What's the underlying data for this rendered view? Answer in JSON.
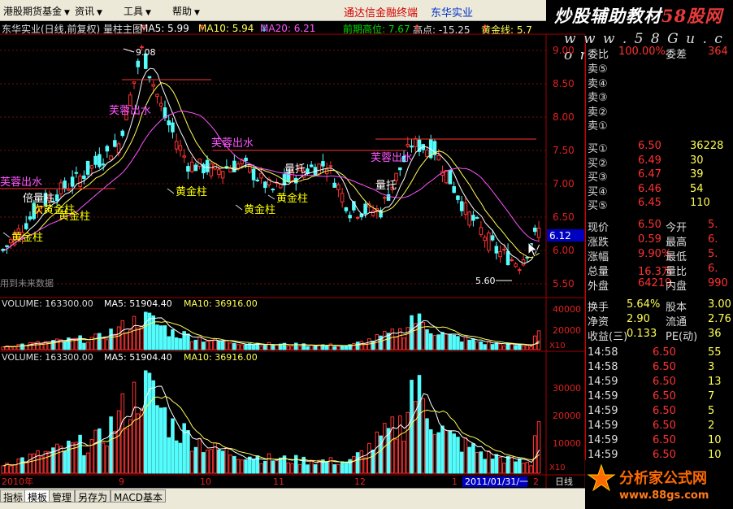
{
  "menu": {
    "items": [
      "港股期货基金",
      "资讯",
      "工具",
      "帮助"
    ],
    "links": [
      "通达信金融终端",
      "东华实业"
    ]
  },
  "logo": {
    "title_prefix": "炒股辅助教材",
    "title_suffix": "58股网",
    "url": "w w w . 5 8 G u . c o m"
  },
  "infobar": {
    "chart_name": "东华实业(日线,前复权) 量柱主图",
    "ma5": "MA5: 5.99",
    "ma10": "MA10: 5.94",
    "ma20": "MA20: 6.21",
    "high_prev": "前期高位: 7.67",
    "high": "高点: -15.25",
    "gold": "黄金线: 5.7"
  },
  "colors": {
    "up": "#ff3232",
    "down": "#54fcfc",
    "ma5": "#ffffff",
    "ma10": "#ffff54",
    "ma20": "#ff54ff",
    "grid": "#a00000",
    "label": "#ffff00",
    "green": "#00cc00"
  },
  "main_chart": {
    "y_axis": [
      "9.00",
      "8.50",
      "8.00",
      "7.50",
      "7.00",
      "6.50",
      "6.00",
      "5.50"
    ],
    "current_price_tag": "6.12",
    "high_label": "9.08",
    "low_label": "5.60",
    "watermark": "用到未来数据",
    "annotations": [
      {
        "text": "黄金柱",
        "color": "#ffff00"
      },
      {
        "text": "倍量柱",
        "color": "#ffffff"
      },
      {
        "text": "次黄金柱",
        "color": "#ffff00"
      },
      {
        "text": "黄金柱",
        "color": "#ffff00"
      },
      {
        "text": "芙蓉出水",
        "color": "#ff54ff"
      },
      {
        "text": "黄金柱",
        "color": "#ffff00"
      },
      {
        "text": "黄金柱",
        "color": "#ffff00"
      },
      {
        "text": "黄金柱",
        "color": "#ffff00"
      },
      {
        "text": "量托",
        "color": "#ffffff"
      },
      {
        "text": "芙蓉出水",
        "color": "#ff54ff"
      },
      {
        "text": "量托",
        "color": "#ffffff"
      },
      {
        "text": "芙蓉出水",
        "color": "#ff54ff"
      },
      {
        "text": "芙蓉出水",
        "color": "#ff54ff"
      }
    ]
  },
  "volume_chart_1": {
    "label_volume": "VOLUME: 163300.00",
    "label_ma5": "MA5: 51904.40",
    "label_ma10": "MA10: 36916.00",
    "y_axis": [
      "40000",
      "20000"
    ],
    "scale": "X10"
  },
  "volume_chart_2": {
    "label_volume": "VOLUME: 163300.00",
    "label_ma5": "MA5: 51904.40",
    "label_ma10": "MA10: 36916.00",
    "y_axis": [
      "30000",
      "20000",
      "10000"
    ],
    "scale": "X10"
  },
  "x_axis": {
    "labels": [
      "2010年",
      "9",
      "10",
      "11",
      "12",
      "1",
      "2011/01/31/一",
      "2"
    ],
    "right_label": "日线"
  },
  "quote_panel": {
    "ratio_label": "委比",
    "ratio_value": "100.00%",
    "diff_label": "委差",
    "diff_value": "364",
    "sells": [
      {
        "label": "卖⑤",
        "price": "",
        "vol": ""
      },
      {
        "label": "卖④",
        "price": "",
        "vol": ""
      },
      {
        "label": "卖③",
        "price": "",
        "vol": ""
      },
      {
        "label": "卖②",
        "price": "",
        "vol": ""
      },
      {
        "label": "卖①",
        "price": "",
        "vol": ""
      }
    ],
    "buys": [
      {
        "label": "买①",
        "price": "6.50",
        "vol": "36228"
      },
      {
        "label": "买②",
        "price": "6.49",
        "vol": "30"
      },
      {
        "label": "买③",
        "price": "6.47",
        "vol": "39"
      },
      {
        "label": "买④",
        "price": "6.46",
        "vol": "54"
      },
      {
        "label": "买⑤",
        "price": "6.45",
        "vol": "110"
      }
    ],
    "stats": [
      {
        "l1": "现价",
        "v1": "6.50",
        "l2": "今开",
        "v2": "5."
      },
      {
        "l1": "涨跌",
        "v1": "0.59",
        "l2": "最高",
        "v2": "6."
      },
      {
        "l1": "涨幅",
        "v1": "9.90%",
        "l2": "最低",
        "v2": "5."
      },
      {
        "l1": "总量",
        "v1": "16.3万",
        "l2": "量比",
        "v2": "6."
      },
      {
        "l1": "外盘",
        "v1": "64219",
        "l2": "内盘",
        "v2": "990"
      }
    ],
    "stats2": [
      {
        "l1": "换手",
        "v1": "5.64%",
        "l2": "股本",
        "v2": "3.00"
      },
      {
        "l1": "净资",
        "v1": "2.90",
        "l2": "流通",
        "v2": "2.76"
      },
      {
        "l1": "收益(三)",
        "v1": "0.133",
        "l2": "PE(动)",
        "v2": "36"
      }
    ],
    "ticks": [
      {
        "time": "14:58",
        "price": "6.50",
        "vol": "55"
      },
      {
        "time": "14:58",
        "price": "6.50",
        "vol": "3"
      },
      {
        "time": "14:59",
        "price": "6.50",
        "vol": "13"
      },
      {
        "time": "14:59",
        "price": "6.50",
        "vol": "7"
      },
      {
        "time": "14:59",
        "price": "6.50",
        "vol": "5"
      },
      {
        "time": "14:59",
        "price": "6.50",
        "vol": "2"
      },
      {
        "time": "14:59",
        "price": "6.50",
        "vol": "10"
      },
      {
        "time": "14:59",
        "price": "6.50",
        "vol": "10"
      }
    ]
  },
  "bottom_tabs": [
    "指标",
    "模板",
    "管理",
    "另存为",
    "MACD基本"
  ],
  "footer": {
    "title": "分析家公式网",
    "url": "www.88gs.com"
  }
}
